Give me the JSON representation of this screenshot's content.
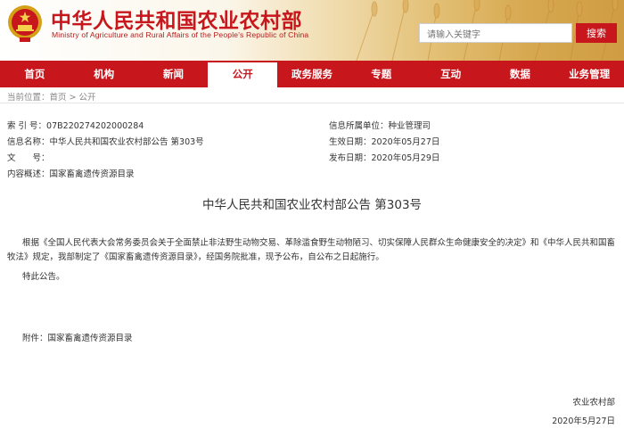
{
  "header": {
    "title": "中华人民共和国农业农村部",
    "subtitle": "Ministry of Agriculture and Rural Affairs of the People's Republic of China",
    "search_placeholder": "请输入关键字",
    "search_button": "搜索",
    "accent_color": "#c8161d"
  },
  "nav": {
    "items": [
      {
        "label": "首页"
      },
      {
        "label": "机构"
      },
      {
        "label": "新闻"
      },
      {
        "label": "公开",
        "active": true
      },
      {
        "label": "政务服务"
      },
      {
        "label": "专题"
      },
      {
        "label": "互动"
      },
      {
        "label": "数据"
      },
      {
        "label": "业务管理"
      }
    ]
  },
  "breadcrumb": {
    "prefix": "当前位置：",
    "home": "首页",
    "separator": " > ",
    "current": "公开"
  },
  "meta": {
    "index_label": "索 引 号：",
    "index_value": "07B220274202000284",
    "category_label": "信息所属单位：",
    "category_value": "种业管理司",
    "name_label": "信息名称：",
    "name_value": "中华人民共和国农业农村部公告 第303号",
    "created_label": "生效日期：",
    "created_value": "2020年05月27日",
    "doc_label": "文　　号：",
    "doc_value": "",
    "published_label": "发布日期：",
    "published_value": "2020年05月29日",
    "summary_label": "内容概述：",
    "summary_value": "国家畜禽遗传资源目录"
  },
  "article": {
    "title": "中华人民共和国农业农村部公告 第303号",
    "paragraph1": "根据《全国人民代表大会常务委员会关于全面禁止非法野生动物交易、革除滥食野生动物陋习、切实保障人民群众生命健康安全的决定》和《中华人民共和国畜牧法》规定，我部制定了《国家畜禽遗传资源目录》，经国务院批准，现予公布，自公布之日起施行。",
    "paragraph2": "特此公告。",
    "attachment": "附件：国家畜禽遗传资源目录",
    "signer": "农业农村部",
    "date": "2020年5月27日"
  }
}
